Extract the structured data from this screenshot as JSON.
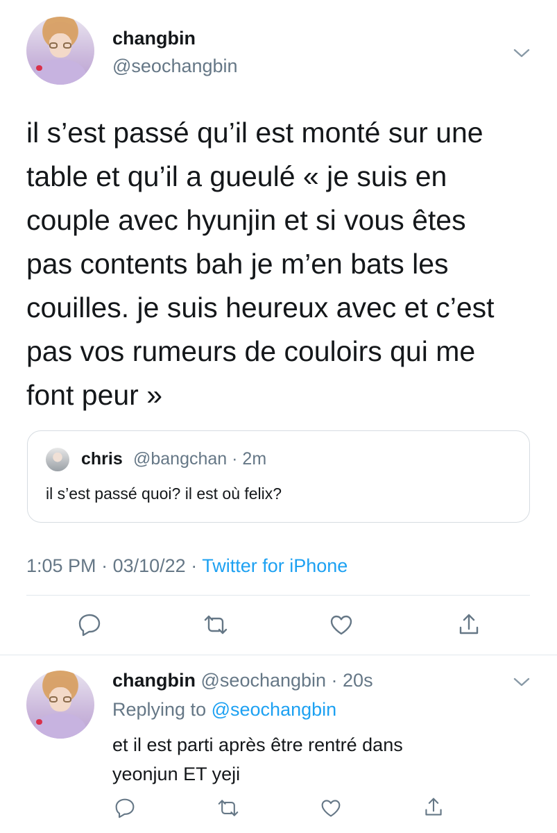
{
  "tweet": {
    "author_name": "changbin",
    "author_handle": "@seochangbin",
    "text_lines": [
      "il s’est passé qu’il est monté sur une",
      "table et qu’il a gueulé « je suis en",
      "couple avec hyunjin et si vous êtes",
      "pas contents bah je m’en bats les",
      "couilles. je suis heureux avec et c’est",
      "pas vos rumeurs de couloirs qui me",
      "font peur »"
    ],
    "quote": {
      "author_name": "chris",
      "author_handle": "@bangchan · 2m",
      "text": "il s’est passé quoi? il est où felix?"
    },
    "time": "1:05 PM",
    "separator": "·",
    "date": "03/10/22",
    "source": "Twitter for iPhone",
    "icons": [
      "reply-icon",
      "retweet-icon",
      "like-icon",
      "share-icon"
    ]
  },
  "reply": {
    "author_name": "changbin",
    "author_handle": "@seochangbin · 20s",
    "replying_label": "Replying to",
    "replying_handle": "@seochangbin",
    "text_lines": [
      "et il est parti après être rentré dans",
      "yeonjun ET yeji"
    ]
  },
  "colors": {
    "text": "#14171a",
    "secondary": "#657786",
    "accent": "#1da1f2",
    "border": "#e1e8ed"
  }
}
